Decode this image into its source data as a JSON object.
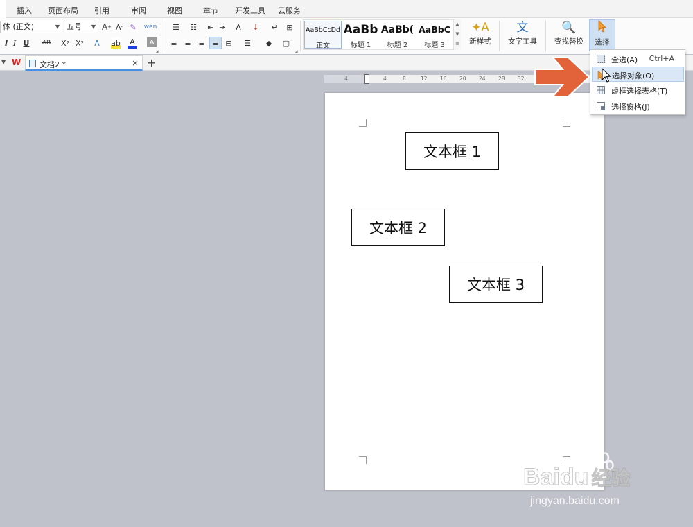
{
  "menu_tabs": [
    "插入",
    "页面布局",
    "引用",
    "审阅",
    "视图",
    "章节",
    "开发工具",
    "云服务"
  ],
  "ribbon": {
    "font_name": "体 (正文)",
    "font_size": "五号",
    "styles": [
      {
        "preview": "AaBbCcDd",
        "name": "正文"
      },
      {
        "preview": "AaBb",
        "name": "标题 1"
      },
      {
        "preview": "AaBb(",
        "name": "标题 2"
      },
      {
        "preview": "AaBbC",
        "name": "标题 3"
      }
    ],
    "new_style_label": "新样式",
    "text_tools_label": "文字工具",
    "find_replace_label": "查找替换",
    "select_label": "选择"
  },
  "doc_tabs": {
    "active_title": "文档2 *"
  },
  "ruler_numbers": [
    "4",
    "4",
    "8",
    "12",
    "16",
    "20",
    "24",
    "28",
    "32"
  ],
  "page": {
    "textboxes": [
      "文本框 1",
      "文本框 2",
      "文本框 3"
    ]
  },
  "select_menu": {
    "items": [
      {
        "label": "全选(A)",
        "shortcut": "Ctrl+A"
      },
      {
        "label": "选择对象(O)",
        "shortcut": ""
      },
      {
        "label": "虚框选择表格(T)",
        "shortcut": ""
      },
      {
        "label": "选择窗格(J)",
        "shortcut": ""
      }
    ]
  },
  "watermark": {
    "brand": "Baidu",
    "brand_cn": "经验",
    "url": "jingyan.baidu.com"
  },
  "colors": {
    "accent": "#4a90e2",
    "arrow": "#e2623a",
    "canvas": "#bfc2cb",
    "menu_highlight": "#dae7f6"
  }
}
